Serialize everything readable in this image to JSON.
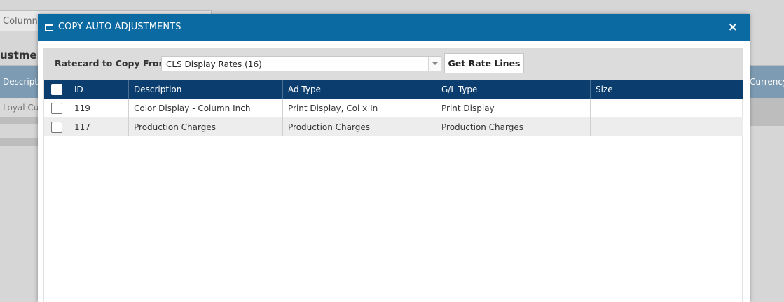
{
  "background": {
    "column_input_text": "Column",
    "heading": "ustment",
    "header_left": "Descripti",
    "header_right": "Currency",
    "row_left": "Loyal Cu"
  },
  "dialog": {
    "title": "COPY AUTO ADJUSTMENTS",
    "close_glyph": "×",
    "ratecard_label": "Ratecard to Copy From",
    "ratecard_value": "CLS Display Rates (16)",
    "get_button": "Get Rate Lines",
    "columns": [
      "ID",
      "Description",
      "Ad Type",
      "G/L Type",
      "Size"
    ],
    "rows": [
      {
        "id": "119",
        "description": "Color Display - Column Inch",
        "ad_type": "Print Display, Col x In",
        "gl_type": "Print Display",
        "size": ""
      },
      {
        "id": "117",
        "description": "Production Charges",
        "ad_type": "Production Charges",
        "gl_type": "Production Charges",
        "size": ""
      }
    ]
  },
  "colors": {
    "header_blue": "#0c6aa3",
    "grid_header": "#0b3d6e",
    "overlay_gray": "#d6d6d6"
  }
}
